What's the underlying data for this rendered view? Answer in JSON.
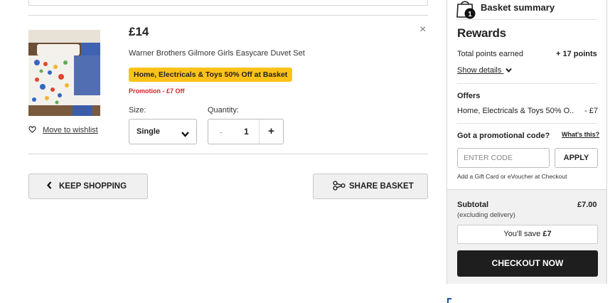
{
  "item": {
    "price": "£14",
    "name": "Warner Brothers Gilmore Girls Easycare Duvet Set",
    "promo_badge": "Home, Electricals & Toys 50% Off at Basket",
    "promo_text": "Promotion - £7 Off",
    "size_label": "Size:",
    "size_value": "Single",
    "quantity_label": "Quantity:",
    "quantity_minus": "-",
    "quantity_value": "1",
    "quantity_plus": "+",
    "wishlist_label": "Move to wishlist",
    "remove_icon": "×"
  },
  "actions": {
    "keep_shopping": "KEEP SHOPPING",
    "share_basket": "SHARE BASKET"
  },
  "summary": {
    "badge_count": "1",
    "title": "Basket summary",
    "rewards_title": "Rewards",
    "points_label": "Total points earned",
    "points_value": "+ 17 points",
    "show_details": "Show details",
    "offers_title": "Offers",
    "offer_name": "Home, Electricals & Toys 50% O...",
    "offer_value": "- £7",
    "promo_question": "Got a promotional code?",
    "whats_this": "What's this?",
    "code_placeholder": "ENTER CODE",
    "apply_label": "APPLY",
    "gift_card_note": "Add a Gift Card or eVoucher at Checkout",
    "subtotal_label": "Subtotal",
    "subtotal_value": "£7.00",
    "subtotal_note": "(excluding delivery)",
    "save_prefix": "You'll save ",
    "save_amount": "£7",
    "checkout_label": "CHECKOUT NOW"
  },
  "colors": {
    "promo_badge_bg": "#fcc21a",
    "promo_text": "#d3232a",
    "checkout_bg": "#1e1e1e"
  },
  "icons": [
    "close-icon",
    "heart-icon",
    "chevron-down-icon",
    "chevron-left-icon",
    "share-icon",
    "basket-bag-icon"
  ]
}
